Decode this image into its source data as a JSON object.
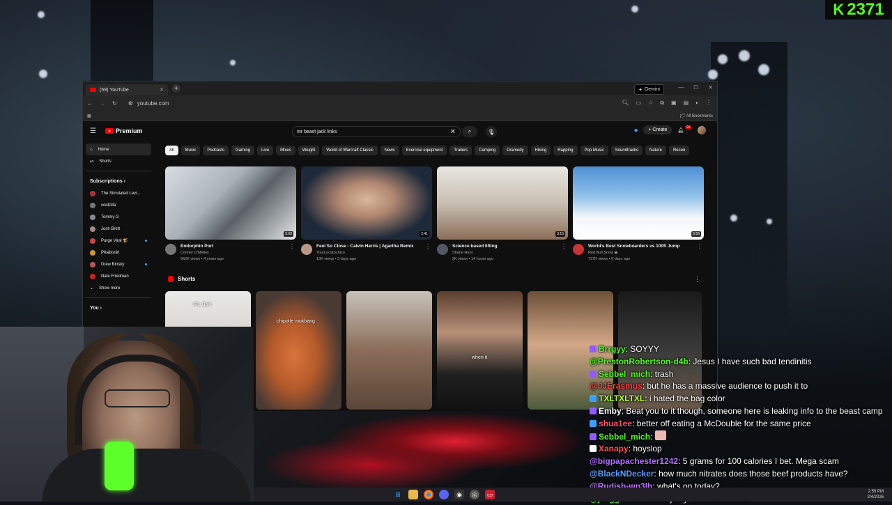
{
  "overlay": {
    "kick_count": "2371",
    "accent": "#53fc18"
  },
  "browser": {
    "tab_title": "(59) YouTube",
    "url": "youtube.com",
    "gemini_label": "Gemini",
    "bookmarks_label": "All Bookmarks"
  },
  "youtube": {
    "logo": "Premium",
    "search_query": "mr beast jack links",
    "create_label": "Create",
    "notif_count": "9+",
    "sidebar": {
      "home": "Home",
      "shorts": "Shorts",
      "subscriptions": "Subscriptions",
      "subs": [
        {
          "name": "The Simulated Levi...",
          "color": "#a33",
          "live": false
        },
        {
          "name": "voidzilla",
          "color": "#777",
          "live": false
        },
        {
          "name": "Tommy G",
          "color": "#889",
          "live": false
        },
        {
          "name": "Josh Brett",
          "color": "#a88",
          "live": false
        },
        {
          "name": "Purge Viral 🐒",
          "color": "#c44",
          "live": true
        },
        {
          "name": "Pikabooirl",
          "color": "#c93",
          "live": false
        },
        {
          "name": "Drew Binsky",
          "color": "#b55",
          "live": true
        },
        {
          "name": "Nate Friedman",
          "color": "#c22",
          "live": false
        }
      ],
      "show_more": "Show more",
      "you": "You"
    },
    "chips": [
      "All",
      "Music",
      "Podcasts",
      "Gaming",
      "Live",
      "Mixes",
      "Weight",
      "World of Warcraft Classic",
      "News",
      "Exercise equipment",
      "Trailers",
      "Camping",
      "Dramedy",
      "Hiking",
      "Rapping",
      "Pop Music",
      "Soundtracks",
      "Nature",
      "Recen"
    ],
    "videos": [
      {
        "title": "Endorphin Port",
        "channel": "Conner O'Malley",
        "meta": "962K views • 4 years ago",
        "duration": "5:00"
      },
      {
        "title": "Feel So Close - Calvin Harris | Agartha Remix",
        "channel": "YourLocalSchizo",
        "meta": "13K views • 3 days ago",
        "duration": "2:41"
      },
      {
        "title": "Science based lifting",
        "channel": "Shane Hunt",
        "meta": "2K views • 14 hours ago",
        "duration": "3:15"
      },
      {
        "title": "World's Best Snowboarders vs 100ft Jump",
        "channel": "Red Bull Snow ◉",
        "meta": "737K views • 6 days ago",
        "duration": "5:56"
      }
    ],
    "shorts_title": "Shorts",
    "shorts": [
      {
        "caption": "IRL Baki"
      },
      {
        "caption": "chipotle mukbang"
      },
      {
        "caption": ""
      },
      {
        "caption": "when it"
      },
      {
        "caption": ""
      },
      {
        "caption": ""
      }
    ]
  },
  "chat": [
    {
      "user": "Brrgyy",
      "color": "#53fc18",
      "text": "SOYYY",
      "icon": "#8e5cff"
    },
    {
      "user": "@PrestonRobertson-d4b",
      "color": "#53fc18",
      "text": "Jesus I have such bad tendinitis",
      "icon": ""
    },
    {
      "user": "Sebbel_mich",
      "color": "#53fc18",
      "text": "trash",
      "icon": "#8e5cff"
    },
    {
      "user": "@JJErasmus",
      "color": "#ff4040",
      "text": "but he has a massive audience to push it to",
      "icon": ""
    },
    {
      "user": "TXLTXLTXL",
      "color": "#b4ff3a",
      "text": "i hated the bag color",
      "icon": "#3aa0ff"
    },
    {
      "user": "Emby",
      "color": "#ffffff",
      "text": "Beat you to it though, someone here is leaking info to the beast camp",
      "icon": "#8e5cff"
    },
    {
      "user": "shua1ee",
      "color": "#ff5070",
      "text": "better off eating a McDouble for the same price",
      "icon": "#3aa0ff"
    },
    {
      "user": "Sebbel_mich",
      "color": "#53fc18",
      "text": "",
      "icon": "#8e5cff"
    },
    {
      "user": "Xanapy",
      "color": "#ff5050",
      "text": "hoyslop",
      "icon": "#ffffff"
    },
    {
      "user": "@bigpapachester1242",
      "color": "#b070ff",
      "text": "5 grams for 100 calories I bet. Mega scam",
      "icon": ""
    },
    {
      "user": "@BlackNDecker",
      "color": "#5a9cff",
      "text": "how much nitrates does those beef products have?",
      "icon": ""
    },
    {
      "user": "@Rudish-wn3lh",
      "color": "#c070ff",
      "text": "what's on today?",
      "icon": ""
    },
    {
      "user": "@jaeggerhead",
      "color": "#53fc18",
      "text": "beef jerky without nitrates?",
      "icon": ""
    }
  ],
  "taskbar": {
    "time": "2:55 PM",
    "date": "2/4/2026"
  }
}
